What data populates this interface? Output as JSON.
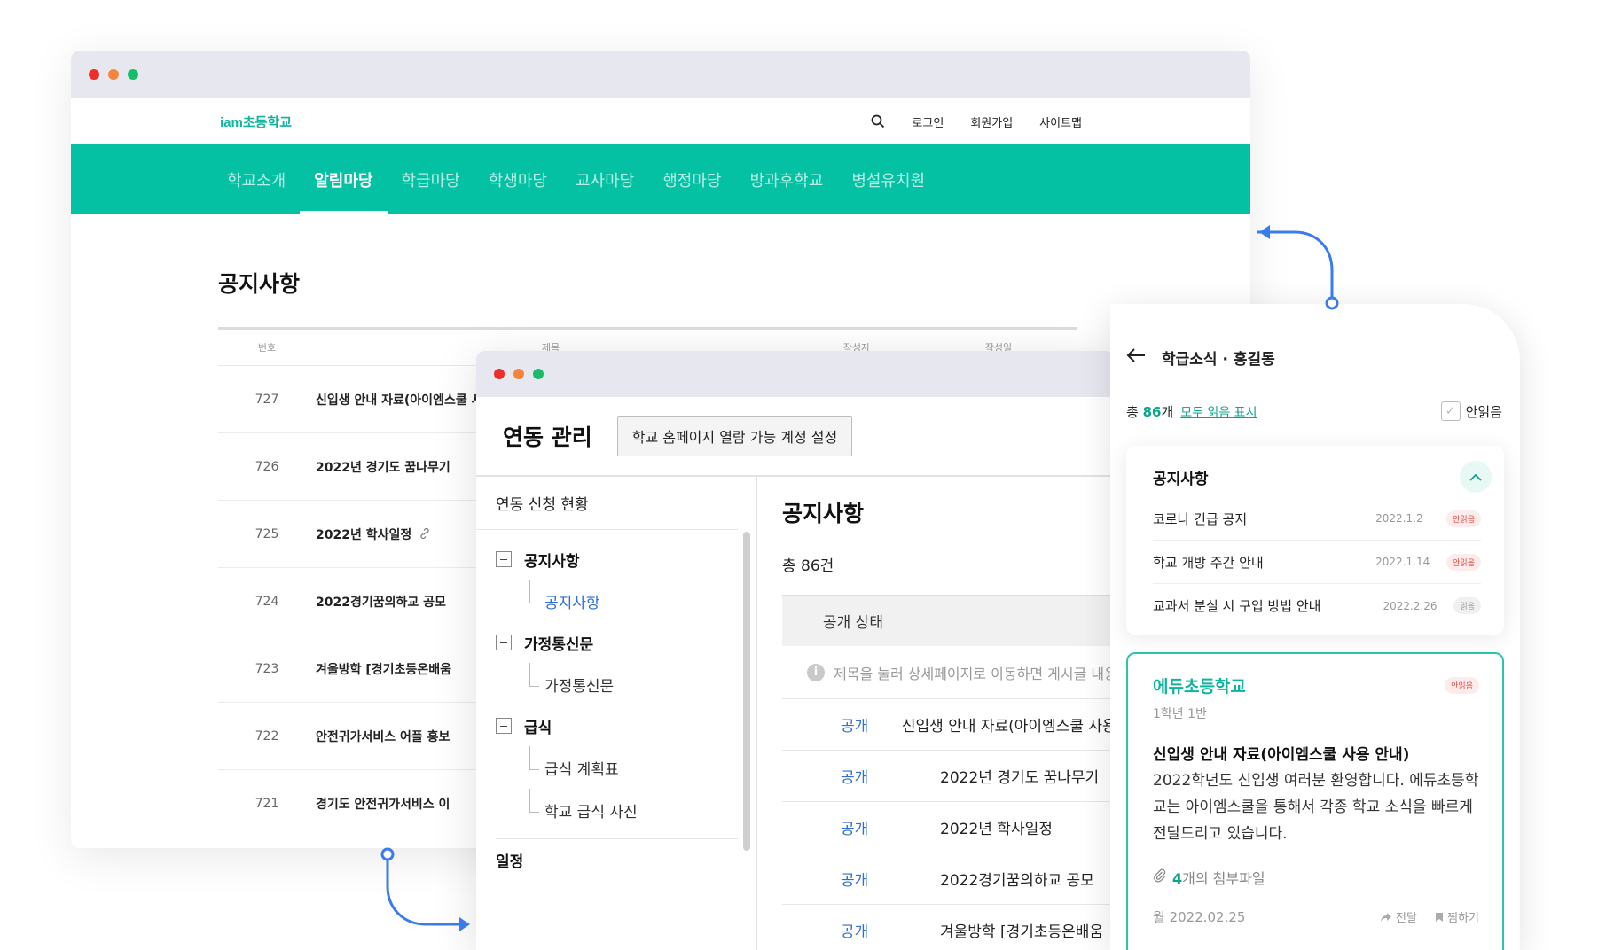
{
  "homepage": {
    "logo": "iam초등학교",
    "top_links": [
      "로그인",
      "회원가입",
      "사이트맵"
    ],
    "nav": [
      "학교소개",
      "알림마당",
      "학급마당",
      "학생마당",
      "교사마당",
      "행정마당",
      "방과후학교",
      "병설유치원"
    ],
    "active_nav": "알림마당",
    "board_title": "공지사항",
    "columns": {
      "no": "번호",
      "title": "제목",
      "author": "작성자",
      "date": "작성일"
    },
    "rows": [
      {
        "no": "727",
        "title": "신입생 안내 자료(아이엠스쿨 사용 안내)"
      },
      {
        "no": "726",
        "title": "2022년 경기도 꿈나무기"
      },
      {
        "no": "725",
        "title": "2022년 학사일정"
      },
      {
        "no": "724",
        "title": "2022경기꿈의하교 공모"
      },
      {
        "no": "723",
        "title": "겨울방학 [경기초등온배움"
      },
      {
        "no": "722",
        "title": "안전귀가서비스 어플 홍보"
      },
      {
        "no": "721",
        "title": "경기도 안전귀가서비스 이"
      }
    ]
  },
  "admin": {
    "title": "연동 관리",
    "settings_button": "학교 홈페이지 열람 가능 계정 설정",
    "sidebar_head": "연동 신청 현황",
    "tree": [
      {
        "group": "공지사항",
        "children": [
          "공지사항"
        ]
      },
      {
        "group": "가정통신문",
        "children": [
          "가정통신문"
        ]
      },
      {
        "group": "급식",
        "children": [
          "급식 계획표",
          "학교 급식 사진"
        ]
      }
    ],
    "tree_single": "일정",
    "main_title": "공지사항",
    "total": "총 86건",
    "status_label": "공개 상태",
    "info_text": "제목을 눌러 상세페이지로 이동하면 게시글 내용을",
    "rows": [
      {
        "status": "공개",
        "title": "신입생 안내 자료(아이엠스쿨 사용 안내)"
      },
      {
        "status": "공개",
        "title": "2022년 경기도 꿈나무기"
      },
      {
        "status": "공개",
        "title": "2022년 학사일정"
      },
      {
        "status": "공개",
        "title": "2022경기꿈의하교 공모"
      },
      {
        "status": "공개",
        "title": "겨울방학 [경기초등온배움"
      }
    ]
  },
  "mobile": {
    "header": "학급소식 · 홍길동",
    "count_prefix": "총 ",
    "count_num": "86",
    "count_suffix": "개",
    "mark_all_read": "모두 읽음 표시",
    "unread_filter": "안읽음",
    "notice_card_title": "공지사항",
    "notices": [
      {
        "title": "코로나 긴급 공지",
        "date": "2022.1.2",
        "tag": "안읽음",
        "read": false
      },
      {
        "title": "학교 개방 주간 안내",
        "date": "2022.1.14",
        "tag": "안읽음",
        "read": false
      },
      {
        "title": "교과서 분실 시 구입 방법 안내",
        "date": "2022.2.26",
        "tag": "읽음",
        "read": true
      }
    ],
    "post": {
      "school": "에듀초등학교",
      "tag": "안읽음",
      "class": "1학년 1반",
      "title": "신입생 안내 자료(아이엠스쿨 사용 안내)",
      "body": "2022학년도 신입생 여러분 환영합니다. 에듀초등학교는 아이엠스쿨을 통해서 각종 학교 소식을 빠르게 전달드리고 있습니다.",
      "attach_num": "4",
      "attach_suffix": "개의 첨부파일",
      "date": "월 2022.02.25",
      "share": "전달",
      "bookmark": "찜하기"
    }
  },
  "colors": {
    "brand": "#05c1a4",
    "link": "#2f6fd6",
    "unread": "#e3443b",
    "connector": "#3a7bef"
  }
}
